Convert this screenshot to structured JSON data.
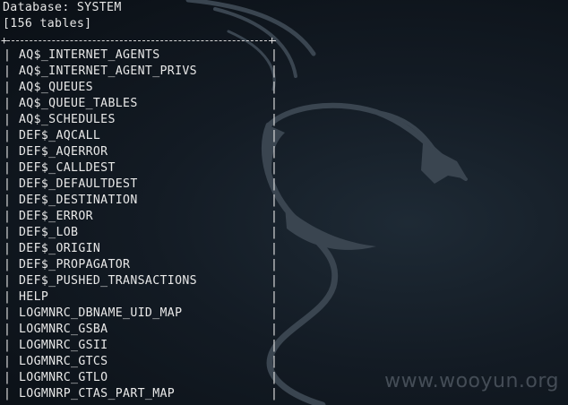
{
  "terminal": {
    "database_line": "Database: SYSTEM",
    "table_count_line": "[156 tables]",
    "rows": [
      "AQ$_INTERNET_AGENTS",
      "AQ$_INTERNET_AGENT_PRIVS",
      "AQ$_QUEUES",
      "AQ$_QUEUE_TABLES",
      "AQ$_SCHEDULES",
      "DEF$_AQCALL",
      "DEF$_AQERROR",
      "DEF$_CALLDEST",
      "DEF$_DEFAULTDEST",
      "DEF$_DESTINATION",
      "DEF$_ERROR",
      "DEF$_LOB",
      "DEF$_ORIGIN",
      "DEF$_PROPAGATOR",
      "DEF$_PUSHED_TRANSACTIONS",
      "HELP",
      "LOGMNRC_DBNAME_UID_MAP",
      "LOGMNRC_GSBA",
      "LOGMNRC_GSII",
      "LOGMNRC_GTCS",
      "LOGMNRC_GTLO",
      "LOGMNRP_CTAS_PART_MAP"
    ]
  },
  "watermark": {
    "text": "www.wooyun.org"
  },
  "colors": {
    "background": "#131b24",
    "text": "#e6e6e6",
    "dragon": "#3a4550"
  },
  "icons": {
    "wallpaper": "kali-dragon-icon"
  }
}
